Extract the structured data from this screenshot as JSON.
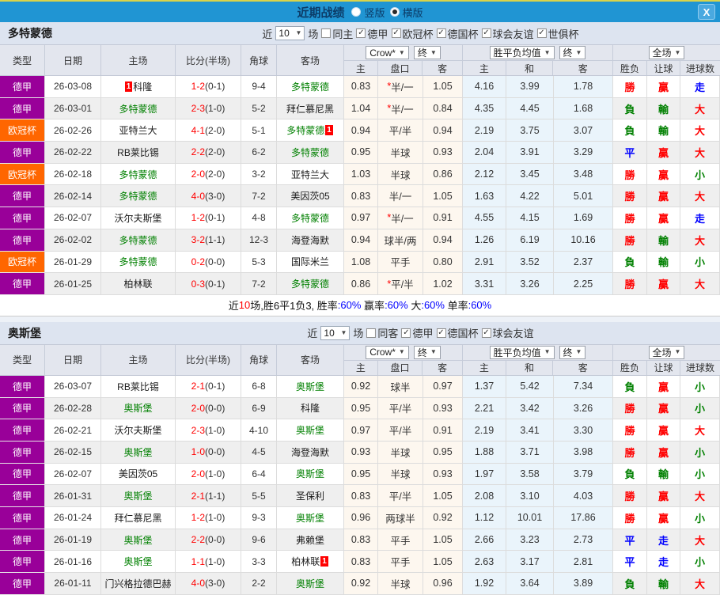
{
  "titlebar": {
    "title": "近期战绩",
    "radios": [
      {
        "label": "竖版",
        "selected": false
      },
      {
        "label": "横版",
        "selected": true
      }
    ],
    "close": "X"
  },
  "header": {
    "left": [
      "类型",
      "日期",
      "主场",
      "比分(半场)",
      "角球",
      "客场"
    ],
    "groups": [
      {
        "dropdowns": [
          "Crow*",
          "终"
        ],
        "subs": [
          "主",
          "盘口",
          "客"
        ]
      },
      {
        "dropdowns": [
          "胜平负均值",
          "终"
        ],
        "subs": [
          "主",
          "和",
          "客"
        ]
      },
      {
        "dropdowns": [
          "全场"
        ],
        "subs": [
          "胜负",
          "让球",
          "进球数"
        ]
      }
    ]
  },
  "colors": {
    "titlebar_bg": "#2095d3",
    "accent_line": "#d9d34a",
    "league": {
      "德甲": "#990099",
      "欧冠杯": "#ff6600"
    },
    "focal_team": "#008000",
    "win": "#ff0000",
    "lose": "#008000",
    "draw": "#0000ff",
    "warm_bg": "#fdf7ef",
    "cool_bg": "#eaf4fb"
  },
  "sections": [
    {
      "team": "多特蒙德",
      "filter": {
        "near": "近",
        "count": "10",
        "unit": "场",
        "same": {
          "label": "同主",
          "checked": false
        },
        "comps": [
          {
            "label": "德甲",
            "checked": true
          },
          {
            "label": "欧冠杯",
            "checked": true
          },
          {
            "label": "德国杯",
            "checked": true
          },
          {
            "label": "球会友谊",
            "checked": true
          },
          {
            "label": "世俱杯",
            "checked": true
          }
        ]
      },
      "rows": [
        {
          "t": "德甲",
          "d": "26-03-08",
          "h": "科隆",
          "hg": false,
          "hb": "1",
          "s": "1-2",
          "sh": "(0-1)",
          "c": "9-4",
          "a": "多特蒙德",
          "ag": true,
          "ab": "",
          "o1": "0.83",
          "hcap": "*半/一",
          "o2": "1.05",
          "v1": "4.16",
          "v2": "3.99",
          "v3": "1.78",
          "r1": "勝",
          "r2": "贏",
          "r3": "走"
        },
        {
          "t": "德甲",
          "d": "26-03-01",
          "h": "多特蒙德",
          "hg": true,
          "hb": "",
          "s": "2-3",
          "sh": "(1-0)",
          "c": "5-2",
          "a": "拜仁慕尼黑",
          "ag": false,
          "ab": "",
          "o1": "1.04",
          "hcap": "*半/一",
          "o2": "0.84",
          "v1": "4.35",
          "v2": "4.45",
          "v3": "1.68",
          "r1": "負",
          "r2": "輸",
          "r3": "大"
        },
        {
          "t": "欧冠杯",
          "d": "26-02-26",
          "h": "亚特兰大",
          "hg": false,
          "hb": "",
          "s": "4-1",
          "sh": "(2-0)",
          "c": "5-1",
          "a": "多特蒙德",
          "ag": true,
          "ab": "1",
          "o1": "0.94",
          "hcap": "平/半",
          "o2": "0.94",
          "v1": "2.19",
          "v2": "3.75",
          "v3": "3.07",
          "r1": "負",
          "r2": "輸",
          "r3": "大"
        },
        {
          "t": "德甲",
          "d": "26-02-22",
          "h": "RB莱比锡",
          "hg": false,
          "hb": "",
          "s": "2-2",
          "sh": "(2-0)",
          "c": "6-2",
          "a": "多特蒙德",
          "ag": true,
          "ab": "",
          "o1": "0.95",
          "hcap": "半球",
          "o2": "0.93",
          "v1": "2.04",
          "v2": "3.91",
          "v3": "3.29",
          "r1": "平",
          "r2": "贏",
          "r3": "大"
        },
        {
          "t": "欧冠杯",
          "d": "26-02-18",
          "h": "多特蒙德",
          "hg": true,
          "hb": "",
          "s": "2-0",
          "sh": "(2-0)",
          "c": "3-2",
          "a": "亚特兰大",
          "ag": false,
          "ab": "",
          "o1": "1.03",
          "hcap": "半球",
          "o2": "0.86",
          "v1": "2.12",
          "v2": "3.45",
          "v3": "3.48",
          "r1": "勝",
          "r2": "贏",
          "r3": "小"
        },
        {
          "t": "德甲",
          "d": "26-02-14",
          "h": "多特蒙德",
          "hg": true,
          "hb": "",
          "s": "4-0",
          "sh": "(3-0)",
          "c": "7-2",
          "a": "美因茨05",
          "ag": false,
          "ab": "",
          "o1": "0.83",
          "hcap": "半/一",
          "o2": "1.05",
          "v1": "1.63",
          "v2": "4.22",
          "v3": "5.01",
          "r1": "勝",
          "r2": "贏",
          "r3": "大"
        },
        {
          "t": "德甲",
          "d": "26-02-07",
          "h": "沃尔夫斯堡",
          "hg": false,
          "hb": "",
          "s": "1-2",
          "sh": "(0-1)",
          "c": "4-8",
          "a": "多特蒙德",
          "ag": true,
          "ab": "",
          "o1": "0.97",
          "hcap": "*半/一",
          "o2": "0.91",
          "v1": "4.55",
          "v2": "4.15",
          "v3": "1.69",
          "r1": "勝",
          "r2": "贏",
          "r3": "走"
        },
        {
          "t": "德甲",
          "d": "26-02-02",
          "h": "多特蒙德",
          "hg": true,
          "hb": "",
          "s": "3-2",
          "sh": "(1-1)",
          "c": "12-3",
          "a": "海登海默",
          "ag": false,
          "ab": "",
          "o1": "0.94",
          "hcap": "球半/两",
          "o2": "0.94",
          "v1": "1.26",
          "v2": "6.19",
          "v3": "10.16",
          "r1": "勝",
          "r2": "輸",
          "r3": "大"
        },
        {
          "t": "欧冠杯",
          "d": "26-01-29",
          "h": "多特蒙德",
          "hg": true,
          "hb": "",
          "s": "0-2",
          "sh": "(0-0)",
          "c": "5-3",
          "a": "国际米兰",
          "ag": false,
          "ab": "",
          "o1": "1.08",
          "hcap": "平手",
          "o2": "0.80",
          "v1": "2.91",
          "v2": "3.52",
          "v3": "2.37",
          "r1": "負",
          "r2": "輸",
          "r3": "小"
        },
        {
          "t": "德甲",
          "d": "26-01-25",
          "h": "柏林联",
          "hg": false,
          "hb": "",
          "s": "0-3",
          "sh": "(0-1)",
          "c": "7-2",
          "a": "多特蒙德",
          "ag": true,
          "ab": "",
          "o1": "0.86",
          "hcap": "*平/半",
          "o2": "1.02",
          "v1": "3.31",
          "v2": "3.26",
          "v3": "2.25",
          "r1": "勝",
          "r2": "贏",
          "r3": "大"
        }
      ],
      "summary": [
        {
          "t": "近",
          "c": "k"
        },
        {
          "t": "10",
          "c": "r"
        },
        {
          "t": "场,胜6平1负3, ",
          "c": "k"
        },
        {
          "t": "胜率",
          "c": "k"
        },
        {
          "t": ":60%",
          "c": "b"
        },
        {
          "t": " 赢率",
          "c": "k"
        },
        {
          "t": ":60%",
          "c": "b"
        },
        {
          "t": " 大",
          "c": "k"
        },
        {
          "t": ":60%",
          "c": "b"
        },
        {
          "t": " 单率",
          "c": "k"
        },
        {
          "t": ":60%",
          "c": "b"
        }
      ]
    },
    {
      "team": "奥斯堡",
      "filter": {
        "near": "近",
        "count": "10",
        "unit": "场",
        "same": {
          "label": "同客",
          "checked": false
        },
        "comps": [
          {
            "label": "德甲",
            "checked": true
          },
          {
            "label": "德国杯",
            "checked": true
          },
          {
            "label": "球会友谊",
            "checked": true
          }
        ]
      },
      "rows": [
        {
          "t": "德甲",
          "d": "26-03-07",
          "h": "RB莱比锡",
          "hg": false,
          "hb": "",
          "s": "2-1",
          "sh": "(0-1)",
          "c": "6-8",
          "a": "奥斯堡",
          "ag": true,
          "ab": "",
          "o1": "0.92",
          "hcap": "球半",
          "o2": "0.97",
          "v1": "1.37",
          "v2": "5.42",
          "v3": "7.34",
          "r1": "負",
          "r2": "贏",
          "r3": "小"
        },
        {
          "t": "德甲",
          "d": "26-02-28",
          "h": "奥斯堡",
          "hg": true,
          "hb": "",
          "s": "2-0",
          "sh": "(0-0)",
          "c": "6-9",
          "a": "科隆",
          "ag": false,
          "ab": "",
          "o1": "0.95",
          "hcap": "平/半",
          "o2": "0.93",
          "v1": "2.21",
          "v2": "3.42",
          "v3": "3.26",
          "r1": "勝",
          "r2": "贏",
          "r3": "小"
        },
        {
          "t": "德甲",
          "d": "26-02-21",
          "h": "沃尔夫斯堡",
          "hg": false,
          "hb": "",
          "s": "2-3",
          "sh": "(1-0)",
          "c": "4-10",
          "a": "奥斯堡",
          "ag": true,
          "ab": "",
          "o1": "0.97",
          "hcap": "平/半",
          "o2": "0.91",
          "v1": "2.19",
          "v2": "3.41",
          "v3": "3.30",
          "r1": "勝",
          "r2": "贏",
          "r3": "大"
        },
        {
          "t": "德甲",
          "d": "26-02-15",
          "h": "奥斯堡",
          "hg": true,
          "hb": "",
          "s": "1-0",
          "sh": "(0-0)",
          "c": "4-5",
          "a": "海登海默",
          "ag": false,
          "ab": "",
          "o1": "0.93",
          "hcap": "半球",
          "o2": "0.95",
          "v1": "1.88",
          "v2": "3.71",
          "v3": "3.98",
          "r1": "勝",
          "r2": "贏",
          "r3": "小"
        },
        {
          "t": "德甲",
          "d": "26-02-07",
          "h": "美因茨05",
          "hg": false,
          "hb": "",
          "s": "2-0",
          "sh": "(1-0)",
          "c": "6-4",
          "a": "奥斯堡",
          "ag": true,
          "ab": "",
          "o1": "0.95",
          "hcap": "半球",
          "o2": "0.93",
          "v1": "1.97",
          "v2": "3.58",
          "v3": "3.79",
          "r1": "負",
          "r2": "輸",
          "r3": "小"
        },
        {
          "t": "德甲",
          "d": "26-01-31",
          "h": "奥斯堡",
          "hg": true,
          "hb": "",
          "s": "2-1",
          "sh": "(1-1)",
          "c": "5-5",
          "a": "圣保利",
          "ag": false,
          "ab": "",
          "o1": "0.83",
          "hcap": "平/半",
          "o2": "1.05",
          "v1": "2.08",
          "v2": "3.10",
          "v3": "4.03",
          "r1": "勝",
          "r2": "贏",
          "r3": "大"
        },
        {
          "t": "德甲",
          "d": "26-01-24",
          "h": "拜仁慕尼黑",
          "hg": false,
          "hb": "",
          "s": "1-2",
          "sh": "(1-0)",
          "c": "9-3",
          "a": "奥斯堡",
          "ag": true,
          "ab": "",
          "o1": "0.96",
          "hcap": "两球半",
          "o2": "0.92",
          "v1": "1.12",
          "v2": "10.01",
          "v3": "17.86",
          "r1": "勝",
          "r2": "贏",
          "r3": "小"
        },
        {
          "t": "德甲",
          "d": "26-01-19",
          "h": "奥斯堡",
          "hg": true,
          "hb": "",
          "s": "2-2",
          "sh": "(0-0)",
          "c": "9-6",
          "a": "弗赖堡",
          "ag": false,
          "ab": "",
          "o1": "0.83",
          "hcap": "平手",
          "o2": "1.05",
          "v1": "2.66",
          "v2": "3.23",
          "v3": "2.73",
          "r1": "平",
          "r2": "走",
          "r3": "大"
        },
        {
          "t": "德甲",
          "d": "26-01-16",
          "h": "奥斯堡",
          "hg": true,
          "hb": "",
          "s": "1-1",
          "sh": "(1-0)",
          "c": "3-3",
          "a": "柏林联",
          "ag": false,
          "ab": "1",
          "o1": "0.83",
          "hcap": "平手",
          "o2": "1.05",
          "v1": "2.63",
          "v2": "3.17",
          "v3": "2.81",
          "r1": "平",
          "r2": "走",
          "r3": "小"
        },
        {
          "t": "德甲",
          "d": "26-01-11",
          "h": "门兴格拉德巴赫",
          "hg": false,
          "hb": "",
          "s": "4-0",
          "sh": "(3-0)",
          "c": "2-2",
          "a": "奥斯堡",
          "ag": true,
          "ab": "",
          "o1": "0.92",
          "hcap": "半球",
          "o2": "0.96",
          "v1": "1.92",
          "v2": "3.64",
          "v3": "3.89",
          "r1": "負",
          "r2": "輸",
          "r3": "大"
        }
      ],
      "summary": null
    }
  ]
}
